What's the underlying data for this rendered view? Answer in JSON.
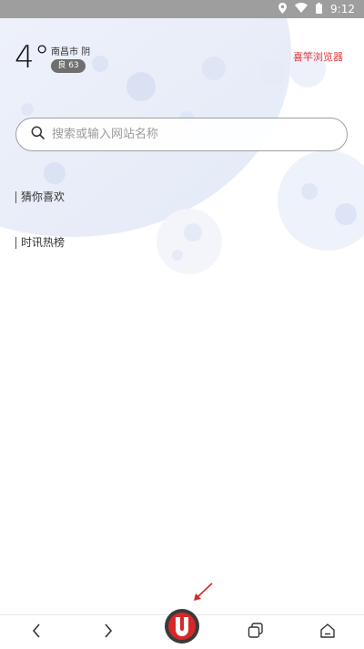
{
  "status_bar": {
    "time": "9:12",
    "icons": [
      "location-icon",
      "wifi-icon",
      "battery-icon"
    ]
  },
  "weather": {
    "temperature": "4°",
    "city": "南昌市 阴",
    "aqi": "良 63"
  },
  "brand": {
    "label": "喜竿浏览器",
    "color": "#e23a3a"
  },
  "search": {
    "placeholder": "搜索或输入网站名称",
    "value": ""
  },
  "sections": [
    {
      "label": "猜你喜欢"
    },
    {
      "label": "时讯热榜"
    }
  ],
  "bottom_nav": {
    "items": [
      {
        "name": "back",
        "icon": "chevron-left-icon"
      },
      {
        "name": "forward",
        "icon": "chevron-right-icon"
      },
      {
        "name": "home-logo",
        "icon": "u-logo-icon"
      },
      {
        "name": "tabs",
        "icon": "tabs-icon"
      },
      {
        "name": "home",
        "icon": "home-icon"
      }
    ]
  },
  "colors": {
    "status_bar": "#9e9e9e",
    "accent_red": "#d62828",
    "background_art": "#e9eef9"
  }
}
